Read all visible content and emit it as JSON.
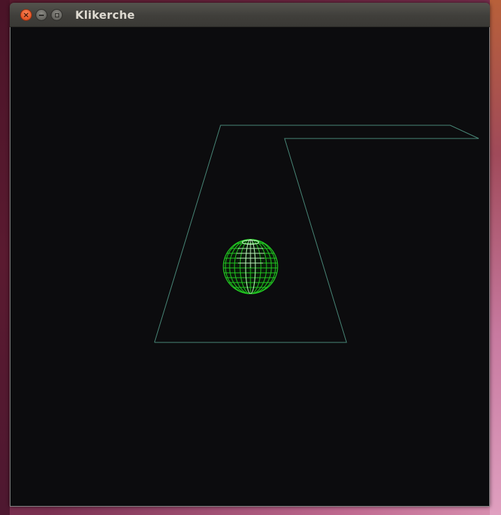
{
  "window": {
    "title": "Klikerche",
    "close_symbol": "×"
  },
  "icons": {
    "close": "close-icon",
    "minimize": "minimize-icon",
    "maximize": "maximize-icon"
  },
  "colors": {
    "canvas_background": "#0c0c0e",
    "track_wireframe": "#4a8a7a",
    "ball_wireframe": "#22cc22",
    "ball_highlight": "#e0ffe0",
    "close_button": "#e85a2a"
  }
}
